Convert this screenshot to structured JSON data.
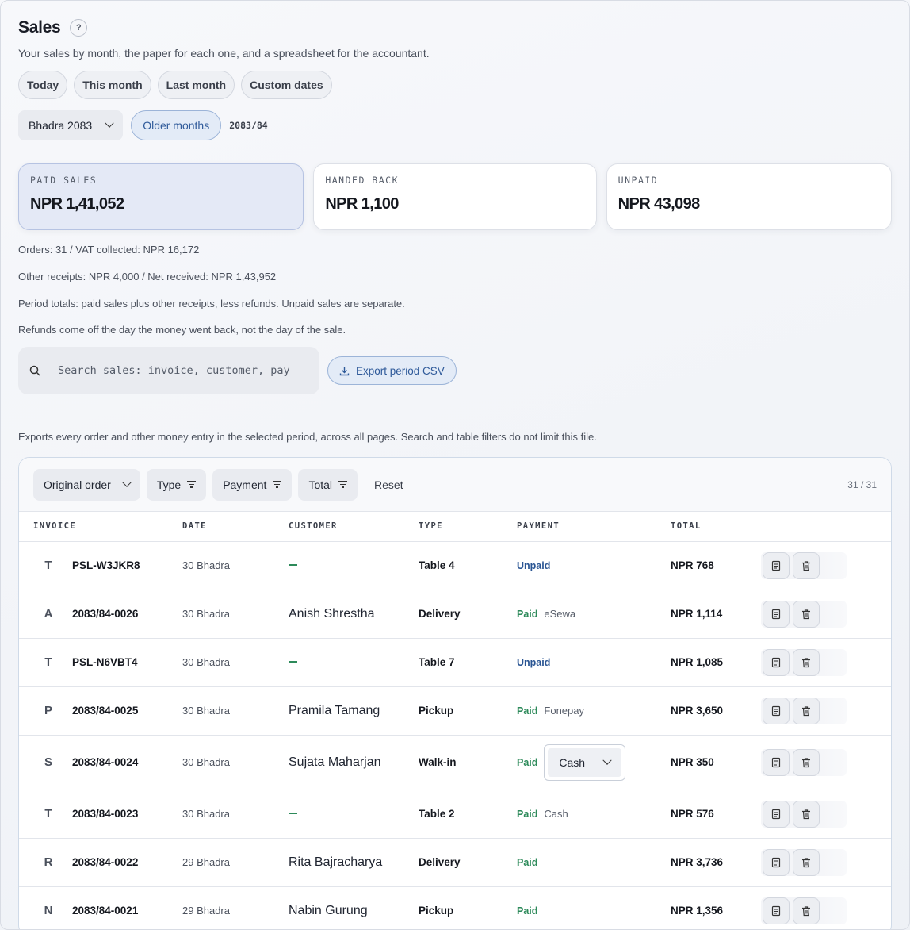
{
  "header": {
    "title": "Sales",
    "help_label": "?",
    "subtitle": "Your sales by month, the paper for each one, and a spreadsheet for the accountant."
  },
  "ranges": [
    "Today",
    "This month",
    "Last month",
    "Custom dates"
  ],
  "month": {
    "selected": "Bhadra 2083",
    "older_label": "Older months",
    "fiscal_year": "2083/84"
  },
  "cards": [
    {
      "label": "PAID SALES",
      "value": "NPR 1,41,052"
    },
    {
      "label": "HANDED BACK",
      "value": "NPR 1,100"
    },
    {
      "label": "UNPAID",
      "value": "NPR 43,098"
    }
  ],
  "notes": {
    "orders": "Orders: 31 / VAT collected: NPR 16,172",
    "receipts": "Other receipts: NPR 4,000 / Net received: NPR 1,43,952",
    "period": "Period totals: paid sales plus other receipts, less refunds. Unpaid sales are separate.",
    "refunds": "Refunds come off the day the money went back, not the day of the sale.",
    "export_info": "Exports every order and other money entry in the selected period, across all pages. Search and table filters do not limit this file."
  },
  "search": {
    "placeholder": "Search sales: invoice, customer, pay"
  },
  "export": {
    "label": "Export period CSV"
  },
  "toolbar": {
    "sort": "Original order",
    "type": "Type",
    "payment": "Payment",
    "total": "Total",
    "reset": "Reset",
    "count": "31 / 31"
  },
  "columns": {
    "invoice": "INVOICE",
    "date": "DATE",
    "customer": "CUSTOMER",
    "type": "TYPE",
    "payment": "PAYMENT",
    "total": "TOTAL"
  },
  "rows": [
    {
      "initial": "T",
      "invoice": "PSL-W3JKR8",
      "date": "30 Bhadra",
      "customer": "",
      "type": "Table 4",
      "status": "Unpaid",
      "method": "",
      "total": "NPR 768"
    },
    {
      "initial": "A",
      "invoice": "2083/84-0026",
      "date": "30 Bhadra",
      "customer": "Anish Shrestha",
      "type": "Delivery",
      "status": "Paid",
      "method": "eSewa",
      "total": "NPR 1,114"
    },
    {
      "initial": "T",
      "invoice": "PSL-N6VBT4",
      "date": "30 Bhadra",
      "customer": "",
      "type": "Table 7",
      "status": "Unpaid",
      "method": "",
      "total": "NPR 1,085"
    },
    {
      "initial": "P",
      "invoice": "2083/84-0025",
      "date": "30 Bhadra",
      "customer": "Pramila Tamang",
      "type": "Pickup",
      "status": "Paid",
      "method": "Fonepay",
      "total": "NPR 3,650"
    },
    {
      "initial": "S",
      "invoice": "2083/84-0024",
      "date": "30 Bhadra",
      "customer": "Sujata Maharjan",
      "type": "Walk-in",
      "status": "Paid",
      "method_select": "Cash",
      "total": "NPR 350"
    },
    {
      "initial": "T",
      "invoice": "2083/84-0023",
      "date": "30 Bhadra",
      "customer": "",
      "type": "Table 2",
      "status": "Paid",
      "method": "Cash",
      "total": "NPR 576"
    },
    {
      "initial": "R",
      "invoice": "2083/84-0022",
      "date": "29 Bhadra",
      "customer": "Rita Bajracharya",
      "type": "Delivery",
      "status": "Paid",
      "method": "",
      "total": "NPR 3,736"
    },
    {
      "initial": "N",
      "invoice": "2083/84-0021",
      "date": "29 Bhadra",
      "customer": "Nabin Gurung",
      "type": "Pickup",
      "status": "Paid",
      "method": "",
      "total": "NPR 1,356"
    }
  ],
  "colors": {
    "paid": "#2d8a5a",
    "unpaid": "#2a5593",
    "accent": "#2f5a9a"
  }
}
